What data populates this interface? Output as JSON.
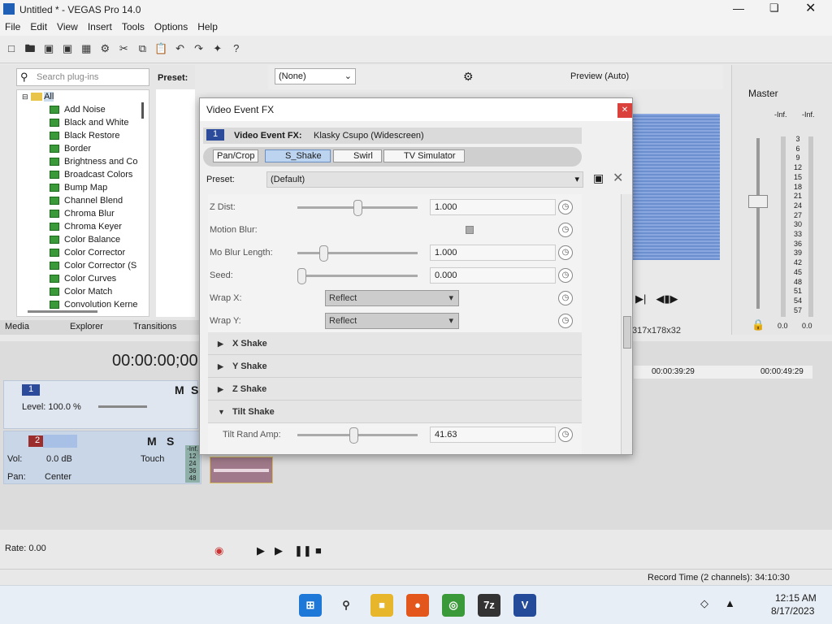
{
  "window": {
    "title": "Untitled * - VEGAS Pro 14.0"
  },
  "menu": [
    "File",
    "Edit",
    "View",
    "Insert",
    "Tools",
    "Options",
    "Help"
  ],
  "plugins": {
    "search_placeholder": "Search plug-ins",
    "root": "All",
    "items": [
      "Add Noise",
      "Black and White",
      "Black Restore",
      "Border",
      "Brightness and Co",
      "Broadcast Colors",
      "Bump Map",
      "Channel Blend",
      "Chroma Blur",
      "Chroma Keyer",
      "Color Balance",
      "Color Corrector",
      "Color Corrector (S",
      "Color Curves",
      "Color Match",
      "Convolution Kerne"
    ]
  },
  "preset_panel": {
    "label": "Preset:"
  },
  "tabs": [
    "Media",
    "Explorer",
    "Transitions"
  ],
  "timecode": "00:00:00;00",
  "track1": {
    "num": "1",
    "level": "Level: 100.0 %"
  },
  "track2": {
    "num": "2",
    "vol_label": "Vol:",
    "vol_value": "0.0 dB",
    "pan_label": "Pan:",
    "pan_value": "Center",
    "mode": "Touch",
    "meter": [
      "-Inf.",
      "12",
      "24",
      "36",
      "48"
    ]
  },
  "preview": {
    "combo": "(None)",
    "mode": "Preview (Auto)",
    "res": "317x178x32"
  },
  "master": {
    "label": "Master",
    "inf_l": "-Inf.",
    "inf_r": "-Inf.",
    "scale": [
      "3",
      "6",
      "9",
      "12",
      "15",
      "18",
      "21",
      "24",
      "27",
      "30",
      "33",
      "36",
      "39",
      "42",
      "45",
      "48",
      "51",
      "54",
      "57"
    ],
    "bottom_l": "0.0",
    "bottom_r": "0.0"
  },
  "ruler": {
    "t1": "00:00:39:29",
    "t2": "00:00:49:29"
  },
  "rate": "Rate: 0.00",
  "status": "Record Time (2 channels): 34:10:30",
  "dialog": {
    "title": "Video Event FX",
    "header_num": "1",
    "header_label": "Video Event FX:",
    "header_name": "Klasky Csupo (Widescreen)",
    "chain": [
      "Pan/Crop",
      "S_Shake",
      "Swirl",
      "TV Simulator"
    ],
    "preset_label": "Preset:",
    "preset_value": "(Default)",
    "rows": [
      {
        "label": "Z Dist:",
        "value": "1.000",
        "pos": 0.5
      },
      {
        "label": "Motion Blur:"
      },
      {
        "label": "Mo Blur Length:",
        "value": "1.000",
        "pos": 0.2
      },
      {
        "label": "Seed:",
        "value": "0.000",
        "pos": 0.0
      },
      {
        "label": "Wrap X:",
        "combo": "Reflect"
      },
      {
        "label": "Wrap Y:",
        "combo": "Reflect"
      }
    ],
    "sections": [
      "X Shake",
      "Y Shake",
      "Z Shake",
      "Tilt Shake"
    ],
    "tilt_label": "Tilt Rand Amp:",
    "tilt_value": "41.63"
  },
  "clock": {
    "time": "12:15 AM",
    "date": "8/17/2023"
  }
}
